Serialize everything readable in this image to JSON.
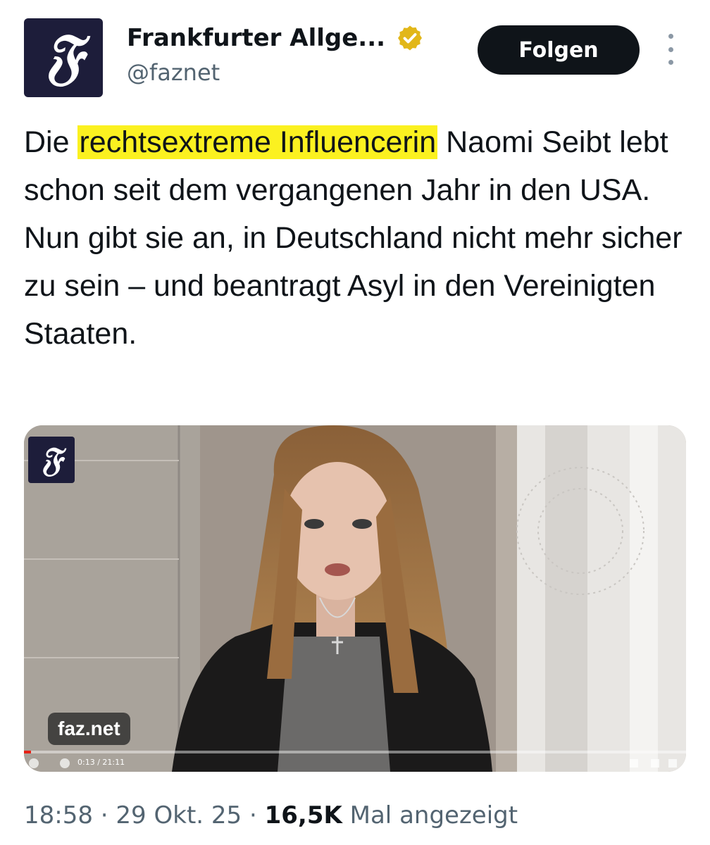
{
  "author": {
    "name": "Frankfurter Allge...",
    "handle": "@faznet",
    "avatar_icon": "faz-logo-icon",
    "verified_icon": "verified-badge-icon",
    "badge_color": "#e2b719"
  },
  "actions": {
    "follow_label": "Folgen",
    "more_icon": "more-options-icon"
  },
  "tweet": {
    "text_before": "Die ",
    "highlight": "rechtsextreme Influencerin",
    "text_after": " Naomi Seibt lebt schon seit dem vergangenen Jahr in den USA. Nun gibt sie an, in Deutschland nicht mehr sicher zu sein – und beantragt Asyl in den Vereinigten Staaten.",
    "highlight_color": "#fbf120"
  },
  "media": {
    "type": "video-thumbnail",
    "watermark_label": "faz.net",
    "time_readout": "0:13 / 21:11",
    "logo_icon": "faz-logo-icon"
  },
  "meta": {
    "time": "18:58",
    "date": "29 Okt. 25",
    "views_count": "16,5K",
    "views_label": "Mal angezeigt",
    "separator": "·"
  }
}
